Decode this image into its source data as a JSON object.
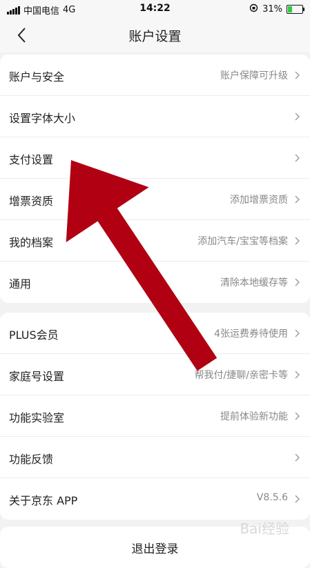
{
  "status_bar": {
    "carrier": "中国电信",
    "network": "4G",
    "time": "14:22",
    "battery": "31%"
  },
  "header": {
    "title": "账户设置"
  },
  "group1": [
    {
      "label": "账户与安全",
      "value": "账户保障可升级"
    },
    {
      "label": "设置字体大小",
      "value": ""
    },
    {
      "label": "支付设置",
      "value": ""
    },
    {
      "label": "增票资质",
      "value": "添加增票资质"
    },
    {
      "label": "我的档案",
      "value": "添加汽车/宝宝等档案"
    },
    {
      "label": "通用",
      "value": "清除本地缓存等"
    }
  ],
  "group2": [
    {
      "label": "PLUS会员",
      "value": "4张运费券待使用"
    },
    {
      "label": "家庭号设置",
      "value": "帮我付/捷聊/亲密卡等"
    },
    {
      "label": "功能实验室",
      "value": "提前体验新功能"
    },
    {
      "label": "功能反馈",
      "value": ""
    },
    {
      "label": "关于京东 APP",
      "value": "V8.5.6"
    }
  ],
  "logout_label": "退出登录",
  "watermark": "Bai经验",
  "colors": {
    "background": "#f2f2f2",
    "annotation_arrow": "#b00012",
    "battery": "#2ecc40"
  },
  "battery_level": 0.31
}
